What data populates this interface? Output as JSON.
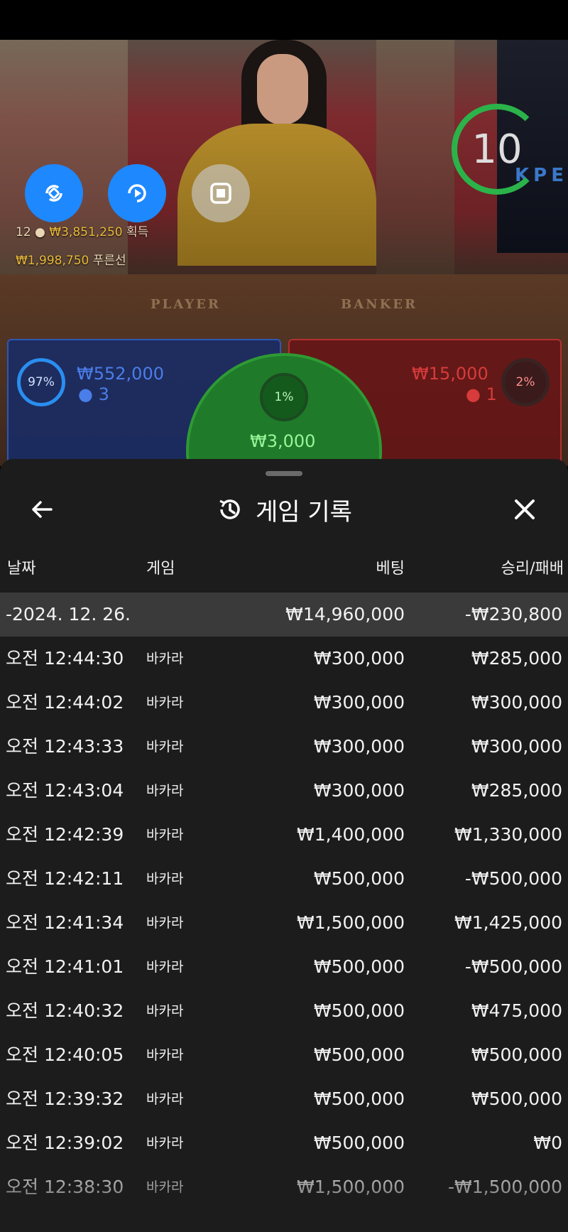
{
  "video": {
    "timer": "10",
    "monitor_text": "KPE",
    "table_labels": {
      "player": "PLAYER",
      "banker": "BANKER"
    },
    "winner_lines": [
      {
        "count": "12",
        "amount": "₩3,851,250",
        "suffix": "획득"
      },
      {
        "amount": "₩1,998,750",
        "suffix": "푸른선"
      }
    ],
    "bets": {
      "player": {
        "percent": "97%",
        "amount": "₩552,000",
        "players": "3"
      },
      "banker": {
        "percent": "2%",
        "amount": "₩15,000",
        "players": "1"
      },
      "tie": {
        "percent": "1%",
        "amount": "₩3,000"
      }
    }
  },
  "sheet": {
    "title": "게임 기록",
    "headers": {
      "date": "날짜",
      "game": "게임",
      "bet": "베팅",
      "winloss": "승리/패배"
    },
    "summary": {
      "date": "-2024. 12. 26.",
      "bet": "₩14,960,000",
      "winloss": "-₩230,800"
    },
    "rows": [
      {
        "time": "오전 12:44:30",
        "game": "바카라",
        "bet": "₩300,000",
        "result": "₩285,000"
      },
      {
        "time": "오전 12:44:02",
        "game": "바카라",
        "bet": "₩300,000",
        "result": "₩300,000"
      },
      {
        "time": "오전 12:43:33",
        "game": "바카라",
        "bet": "₩300,000",
        "result": "₩300,000"
      },
      {
        "time": "오전 12:43:04",
        "game": "바카라",
        "bet": "₩300,000",
        "result": "₩285,000"
      },
      {
        "time": "오전 12:42:39",
        "game": "바카라",
        "bet": "₩1,400,000",
        "result": "₩1,330,000"
      },
      {
        "time": "오전 12:42:11",
        "game": "바카라",
        "bet": "₩500,000",
        "result": "-₩500,000"
      },
      {
        "time": "오전 12:41:34",
        "game": "바카라",
        "bet": "₩1,500,000",
        "result": "₩1,425,000"
      },
      {
        "time": "오전 12:41:01",
        "game": "바카라",
        "bet": "₩500,000",
        "result": "-₩500,000"
      },
      {
        "time": "오전 12:40:32",
        "game": "바카라",
        "bet": "₩500,000",
        "result": "₩475,000"
      },
      {
        "time": "오전 12:40:05",
        "game": "바카라",
        "bet": "₩500,000",
        "result": "₩500,000"
      },
      {
        "time": "오전 12:39:32",
        "game": "바카라",
        "bet": "₩500,000",
        "result": "₩500,000"
      },
      {
        "time": "오전 12:39:02",
        "game": "바카라",
        "bet": "₩500,000",
        "result": "₩0"
      },
      {
        "time": "오전 12:38:30",
        "game": "바카라",
        "bet": "₩1,500,000",
        "result": "-₩1,500,000"
      }
    ]
  },
  "colors": {
    "player_blue": "#2c58b8",
    "banker_red": "#b33030",
    "tie_green": "#2e9a34",
    "accent_blue": "#1e88ff"
  },
  "icons": [
    "rotate-icon",
    "replay-icon",
    "stop-icon",
    "back-arrow-icon",
    "history-icon",
    "close-icon",
    "person-icon"
  ]
}
